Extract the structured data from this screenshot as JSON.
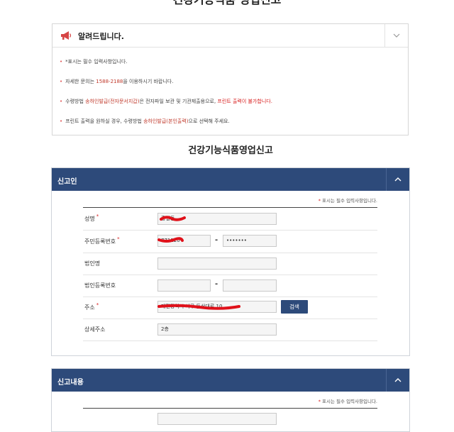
{
  "page": {
    "title": "건강기능식품 영업신고"
  },
  "notice": {
    "title": "알려드립니다.",
    "lines": [
      {
        "pre": "*표시는 필수 입력사항입니다.",
        "hl": "",
        "mid": "",
        "red": "",
        "post": ""
      },
      {
        "pre": "자세한 문의는 ",
        "hl": "1588-2188",
        "mid": "을 이용하시기 바랍니다.",
        "red": "",
        "post": ""
      },
      {
        "pre": "수령방법 ",
        "hl": "송하인발급(전자문서지갑)",
        "mid": "은 전자파일 보관 및 기관제출용으로, ",
        "red": "프린트 출력이 불가합니다.",
        "post": ""
      },
      {
        "pre": "프린트 출력을 원하실 경우, 수령방법 ",
        "hl": "송하인발급(본인출력)",
        "mid": "으로 선택해 주세요.",
        "red": "",
        "post": ""
      }
    ]
  },
  "form_title": "건강기능식품영업신고",
  "reporter": {
    "header": "신고인",
    "required_note": "표시는 필수 입력사항입니다.",
    "fields": {
      "name": {
        "label": "성명",
        "value": "홍길동"
      },
      "rrn": {
        "label": "주민등록번호",
        "front": "771120",
        "back": "•••••••"
      },
      "corp_name": {
        "label": "법인명",
        "value": ""
      },
      "corp_no": {
        "label": "법인등록번호",
        "front": "",
        "back": ""
      },
      "address": {
        "label": "주소",
        "value": "대전광역시 서구 둔산대로 10",
        "button": "검색"
      },
      "address_detail": {
        "label": "상세주소",
        "value": "2층"
      }
    }
  },
  "report_content": {
    "header": "신고내용",
    "required_note": "표시는 필수 입력사항입니다."
  },
  "colors": {
    "panel_header": "#2d4a7a",
    "required": "#d71c1c",
    "redaction": "#e0111a"
  }
}
